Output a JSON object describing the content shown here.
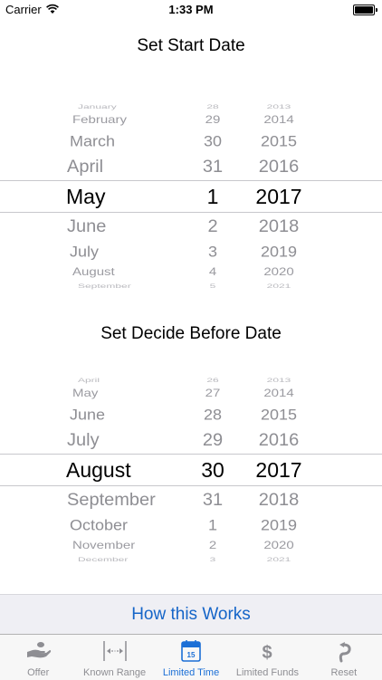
{
  "status_bar": {
    "carrier": "Carrier",
    "time": "1:33 PM"
  },
  "start_picker": {
    "title": "Set Start Date",
    "months": [
      "January",
      "February",
      "March",
      "April",
      "May",
      "June",
      "July",
      "August",
      "September"
    ],
    "days": [
      "28",
      "29",
      "30",
      "31",
      "1",
      "2",
      "3",
      "4",
      "5"
    ],
    "years": [
      "2013",
      "2014",
      "2015",
      "2016",
      "2017",
      "2018",
      "2019",
      "2020",
      "2021"
    ],
    "selected": {
      "month": "May",
      "day": "1",
      "year": "2017"
    }
  },
  "decide_picker": {
    "title": "Set Decide Before Date",
    "months": [
      "April",
      "May",
      "June",
      "July",
      "August",
      "September",
      "October",
      "November",
      "December"
    ],
    "days": [
      "26",
      "27",
      "28",
      "29",
      "30",
      "31",
      "1",
      "2",
      "3"
    ],
    "years": [
      "2013",
      "2014",
      "2015",
      "2016",
      "2017",
      "2018",
      "2019",
      "2020",
      "2021"
    ],
    "selected": {
      "month": "August",
      "day": "30",
      "year": "2017"
    }
  },
  "how_link": "How this Works",
  "tabs": [
    {
      "label": "Offer",
      "icon": "hand-offer-icon",
      "active": false
    },
    {
      "label": "Known Range",
      "icon": "range-arrows-icon",
      "active": false
    },
    {
      "label": "Limited Time",
      "icon": "calendar-icon",
      "active": true
    },
    {
      "label": "Limited Funds",
      "icon": "dollar-icon",
      "active": false
    },
    {
      "label": "Reset",
      "icon": "reset-arrow-icon",
      "active": false
    }
  ],
  "calendar_icon_day": "15",
  "colors": {
    "accent": "#1b6fd6",
    "link": "#1565c8",
    "inactive": "#8e8e93",
    "bar_bg": "#efeff4"
  }
}
